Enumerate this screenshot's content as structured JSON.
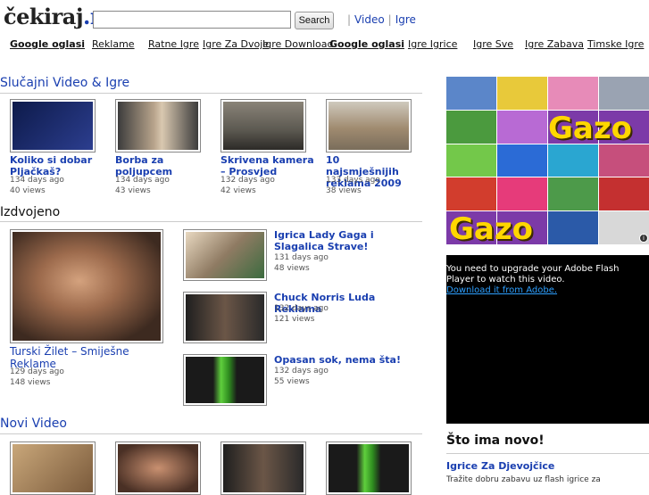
{
  "header": {
    "logo": "čekiraj",
    "logo_suffix": ".me",
    "search_placeholder": "",
    "search_button": "Search",
    "links": [
      "Video",
      "Igre"
    ]
  },
  "categories": [
    {
      "label": "Google oglasi",
      "bold": true
    },
    {
      "label": "Reklame"
    },
    {
      "label": "Ratne Igre"
    },
    {
      "label": "Igre Za Dvoje"
    },
    {
      "label": "Igre Download"
    },
    {
      "label": "Google oglasi",
      "bold": true
    },
    {
      "label": "Igre Igrice"
    },
    {
      "label": "Igre Sve"
    },
    {
      "label": "Igre Zabava"
    },
    {
      "label": "Timske Igre"
    }
  ],
  "random": {
    "title": "Slučajni Video & Igre",
    "items": [
      {
        "title": "Koliko si dobar Pljačkaš?",
        "age": "134 days ago",
        "views": "40 views"
      },
      {
        "title": "Borba za poljupcem",
        "age": "134 days ago",
        "views": "43 views"
      },
      {
        "title": "Skrivena kamera – Prosvjed",
        "age": "132 days ago",
        "views": "42 views"
      },
      {
        "title": "10 najsmješnijih reklama 2009",
        "age": "133 days ago",
        "views": "38 views"
      }
    ]
  },
  "featured": {
    "title": "Izdvojeno",
    "main": {
      "title": "Turski Žilet – Smiješne Reklame",
      "age": "129 days ago",
      "views": "148 views"
    },
    "items": [
      {
        "title": "Igrica Lady Gaga i Slagalica Strave!",
        "age": "131 days ago",
        "views": "48 views"
      },
      {
        "title": "Chuck Norris Luda Reklama",
        "age": "132 days ago",
        "views": "121 views"
      },
      {
        "title": "Opasan sok, nema šta!",
        "age": "132 days ago",
        "views": "55 views"
      }
    ]
  },
  "new_video": {
    "title": "Novi Video"
  },
  "ad": {
    "brand_top": "Gazo",
    "brand_bottom": "Gazo"
  },
  "flash": {
    "message": "You need to upgrade your Adobe Flash Player to watch this video.",
    "link": "Download it from Adobe."
  },
  "news": {
    "title": "Što ima novo!",
    "link": "Igrice Za Djevojčice",
    "text": "Tražite dobru zabavu uz flash igrice za"
  },
  "colors": {
    "link": "#1a3fb0",
    "flash_bg": "#000000"
  }
}
